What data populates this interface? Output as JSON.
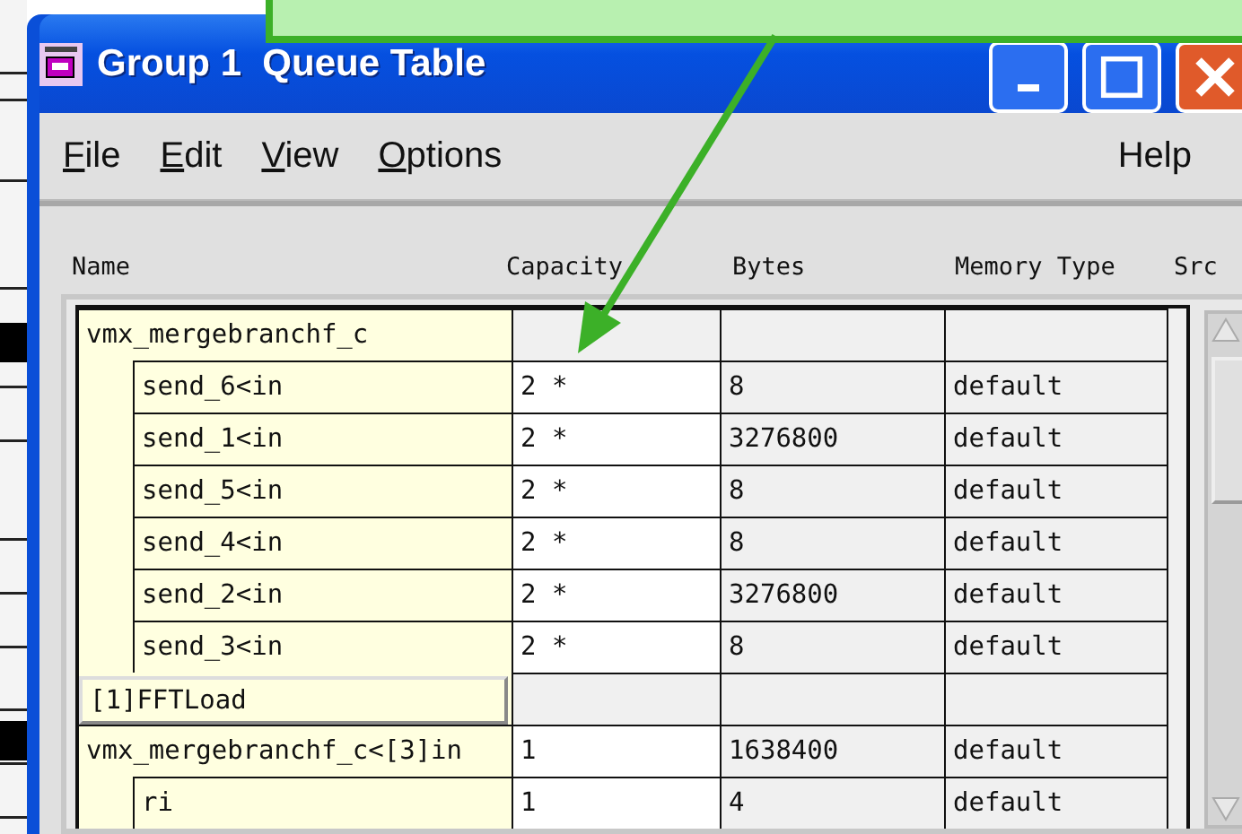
{
  "window": {
    "title": "Group 1  Queue Table"
  },
  "menu": {
    "left": [
      {
        "mnemonic": "F",
        "rest": "ile"
      },
      {
        "mnemonic": "E",
        "rest": "dit"
      },
      {
        "mnemonic": "V",
        "rest": "iew"
      },
      {
        "mnemonic": "O",
        "rest": "ptions"
      }
    ],
    "right": [
      "Help"
    ]
  },
  "table": {
    "columns": [
      "Name",
      "Capacity",
      "Bytes",
      "Memory Type",
      "Src"
    ],
    "rows": [
      {
        "kind": "group",
        "name": "vmx_mergebranchf_c",
        "children": [
          {
            "kind": "item",
            "name": "send_6<in",
            "capacity": "2 *",
            "bytes": "8",
            "memory": "default"
          },
          {
            "kind": "item",
            "name": "send_1<in",
            "capacity": "2 *",
            "bytes": "3276800",
            "memory": "default"
          },
          {
            "kind": "item",
            "name": "send_5<in",
            "capacity": "2 *",
            "bytes": "8",
            "memory": "default"
          },
          {
            "kind": "item",
            "name": "send_4<in",
            "capacity": "2 *",
            "bytes": "8",
            "memory": "default"
          },
          {
            "kind": "item",
            "name": "send_2<in",
            "capacity": "2 *",
            "bytes": "3276800",
            "memory": "default"
          },
          {
            "kind": "item",
            "name": "send_3<in",
            "capacity": "2 *",
            "bytes": "8",
            "memory": "default"
          }
        ]
      },
      {
        "kind": "label",
        "name": "[1]FFTLoad"
      },
      {
        "kind": "group",
        "name": "vmx_mergebranchf_c<[3]in",
        "capacity": "1",
        "bytes": "1638400",
        "memory": "default",
        "children": [
          {
            "kind": "item",
            "name": "ri",
            "capacity": "1",
            "bytes": "4",
            "memory": "default"
          }
        ]
      }
    ]
  }
}
